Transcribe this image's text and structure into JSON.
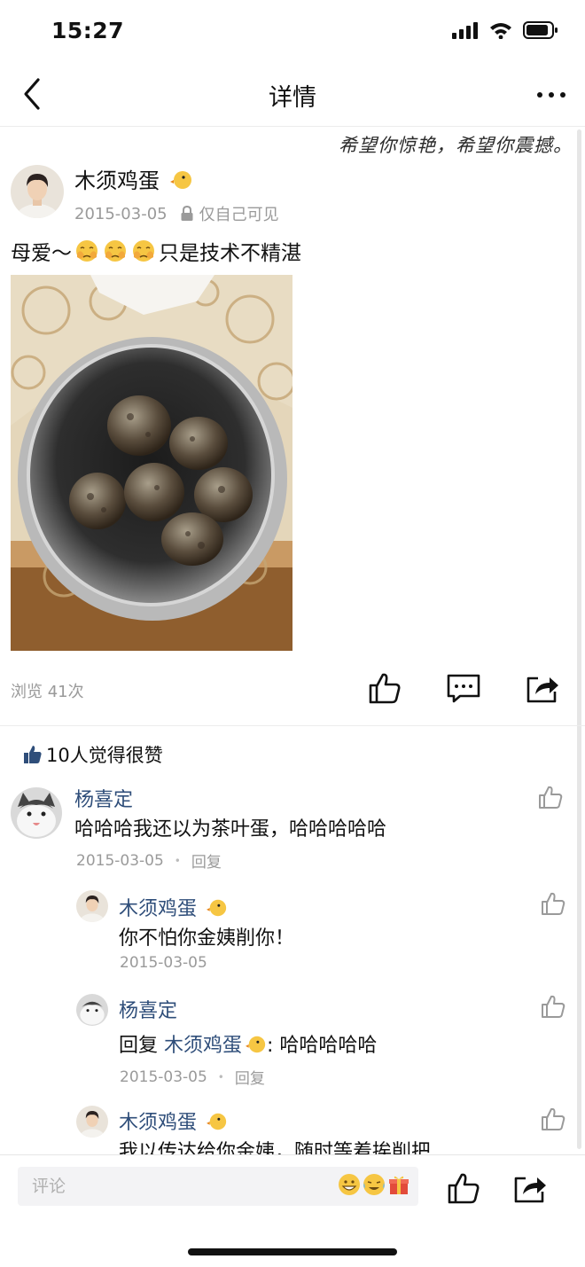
{
  "status_bar": {
    "time": "15:27"
  },
  "nav": {
    "title": "详情",
    "back_icon": "chevron-left-icon",
    "more_icon": "more-dots-icon"
  },
  "watermark": "希望你惊艳，希望你震撼。",
  "post": {
    "author": "木须鸡蛋",
    "date": "2015-03-05",
    "visibility": "仅自己可见",
    "text_before": "母爱～",
    "text_after": "只是技术不精湛",
    "views": "浏览 41次"
  },
  "likes_summary": "10人觉得很赞",
  "comments": [
    {
      "name": "杨喜定",
      "text": "哈哈哈我还以为茶叶蛋，哈哈哈哈哈",
      "date": "2015-03-05",
      "reply_label": "回复"
    },
    {
      "name": "木须鸡蛋",
      "text": "你不怕你金姨削你！",
      "date": "2015-03-05"
    },
    {
      "name": "杨喜定",
      "reply_prefix": "回复",
      "reply_to": "木须鸡蛋",
      "text": ": 哈哈哈哈哈",
      "date": "2015-03-05",
      "reply_label": "回复"
    },
    {
      "name": "木须鸡蛋",
      "text": "我以传达给你金姨，随时等着挨削把"
    }
  ],
  "bottom_bar": {
    "comment_placeholder": "评论"
  },
  "colors": {
    "name_link": "#2f4e7a",
    "meta_gray": "#9a9a9a"
  }
}
